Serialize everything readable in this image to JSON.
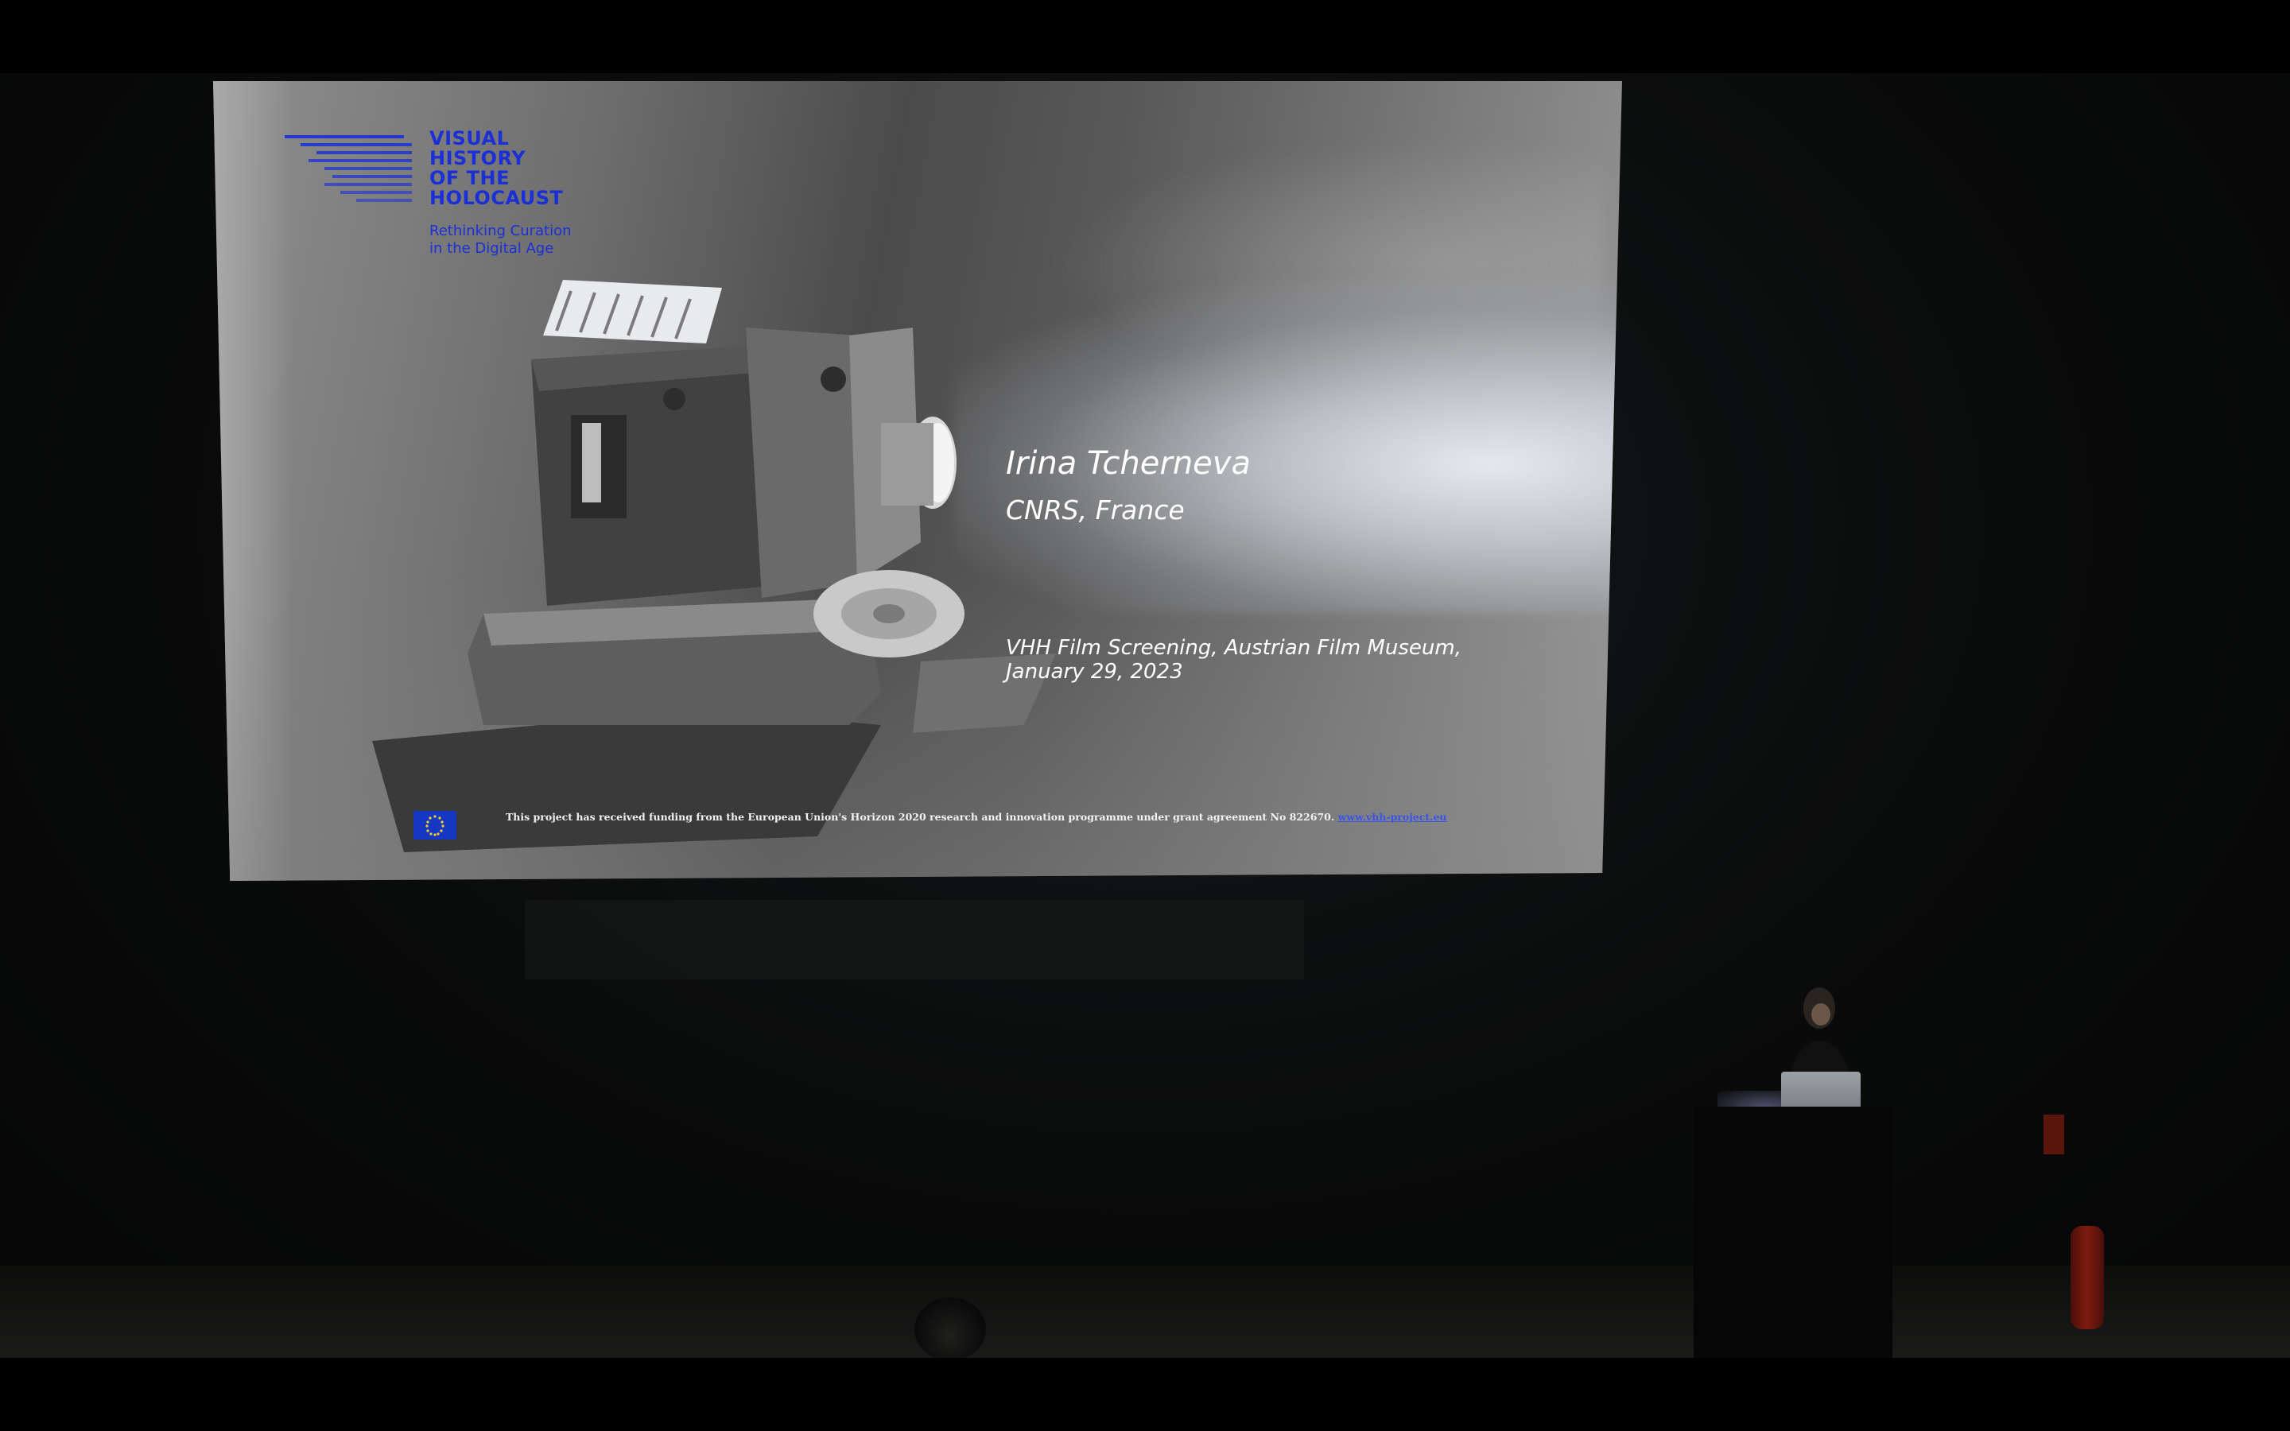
{
  "slide": {
    "logo_title_lines": [
      "VISUAL",
      "HISTORY",
      "OF THE",
      "HOLOCAUST"
    ],
    "logo_subtitle_lines": [
      "Rethinking Curation",
      "in the Digital Age"
    ],
    "speaker_name": "Irina Tcherneva",
    "speaker_affiliation": "CNRS, France",
    "event_line_1": "VHH Film Screening, Austrian Film Museum,",
    "event_line_2": "January 29, 2023",
    "funding_text": "This project has received funding from the European Union's Horizon 2020 research and innovation programme under grant agreement No 822670.",
    "funding_link": "www.vhh-project.eu",
    "eu_flag_icon": "eu-flag-icon"
  },
  "colors": {
    "logo_blue": "#1a2fd6",
    "slide_text": "#ffffff",
    "letterbox": "#000000"
  }
}
